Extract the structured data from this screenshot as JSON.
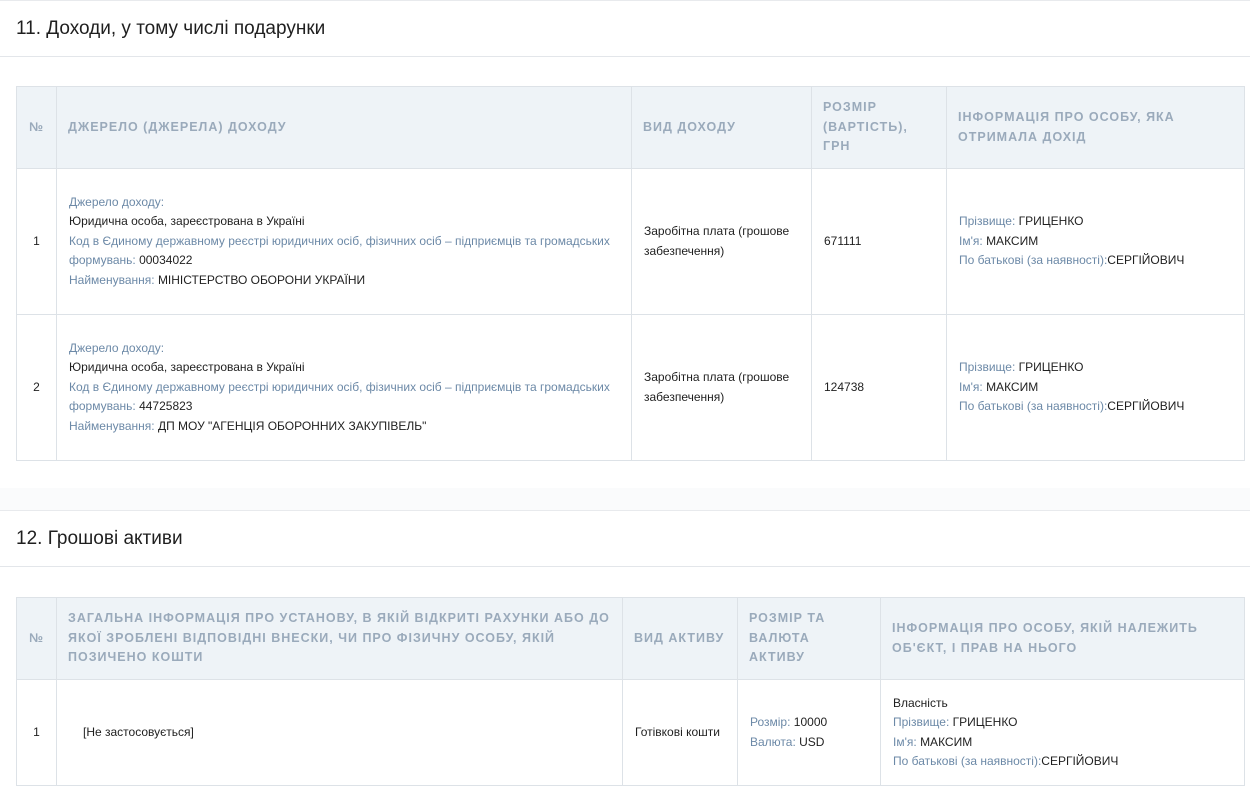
{
  "section11": {
    "title": "11. Доходи, у тому числі подарунки",
    "headers": {
      "num": "№",
      "source": "ДЖЕРЕЛО (ДЖЕРЕЛА) ДОХОДУ",
      "type": "ВИД ДОХОДУ",
      "amount": "РОЗМІР (ВАРТІСТЬ), ГРН",
      "person": "ІНФОРМАЦІЯ ПРО ОСОБУ, ЯКА ОТРИМАЛА ДОХІД"
    },
    "labels": {
      "source": "Джерело доходу:",
      "code": "Код в Єдиному державному реєстрі юридичних осіб, фізичних осіб – підприємців та громадських формувань:",
      "name": "Найменування:",
      "surname": "Прізвище:",
      "first_name": "Ім'я:",
      "patronymic": "По батькові (за наявності):"
    },
    "rows": [
      {
        "num": "1",
        "source_value": "Юридична особа, зареєстрована в Україні",
        "code_value": "00034022",
        "name_value": "МІНІСТЕРСТВО ОБОРОНИ УКРАЇНИ",
        "income_type": "Заробітна плата (грошове забезпечення)",
        "amount": "671111",
        "surname": "ГРИЦЕНКО",
        "first_name": "МАКСИМ",
        "patronymic": "СЕРГІЙОВИЧ"
      },
      {
        "num": "2",
        "source_value": "Юридична особа, зареєстрована в Україні",
        "code_value": "44725823",
        "name_value": "ДП МОУ \"АГЕНЦІЯ ОБОРОННИХ ЗАКУПІВЕЛЬ\"",
        "income_type": "Заробітна плата (грошове забезпечення)",
        "amount": "124738",
        "surname": "ГРИЦЕНКО",
        "first_name": "МАКСИМ",
        "patronymic": "СЕРГІЙОВИЧ"
      }
    ]
  },
  "section12": {
    "title": "12. Грошові активи",
    "headers": {
      "num": "№",
      "info": "ЗАГАЛЬНА ІНФОРМАЦІЯ ПРО УСТАНОВУ, В ЯКІЙ ВІДКРИТІ РАХУНКИ АБО ДО ЯКОЇ ЗРОБЛЕНІ ВІДПОВІДНІ ВНЕСКИ, ЧИ ПРО ФІЗИЧНУ ОСОБУ, ЯКІЙ ПОЗИЧЕНО КОШТИ",
      "asset_type": "ВИД АКТИВУ",
      "amount_currency": "РОЗМІР ТА ВАЛЮТА АКТИВУ",
      "owner": "ІНФОРМАЦІЯ ПРО ОСОБУ, ЯКІЙ НАЛЕЖИТЬ ОБ'ЄКТ, І ПРАВ НА НЬОГО"
    },
    "labels": {
      "size": "Розмір:",
      "currency": "Валюта:",
      "surname": "Прізвище:",
      "first_name": "Ім'я:",
      "patronymic": "По батькові (за наявності):"
    },
    "rows": [
      {
        "num": "1",
        "info": "[Не застосовується]",
        "asset_type": "Готівкові кошти",
        "size": "10000",
        "currency": "USD",
        "ownership": "Власність",
        "surname": "ГРИЦЕНКО",
        "first_name": "МАКСИМ",
        "patronymic": "СЕРГІЙОВИЧ"
      }
    ]
  }
}
